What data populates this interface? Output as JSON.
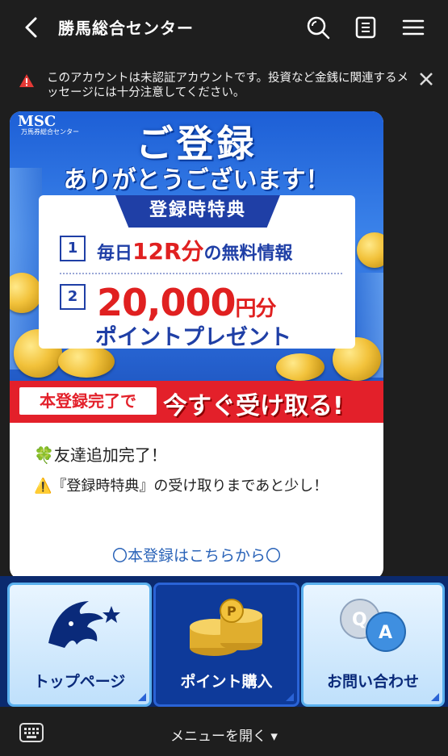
{
  "header": {
    "title": "勝馬総合センター",
    "back_icon": "chevron-left-icon",
    "search_icon": "search-icon",
    "notes_icon": "notes-icon",
    "menu_icon": "hamburger-menu-icon"
  },
  "warning": {
    "text": "このアカウントは未認証アカウントです。投資など金銭に関連するメッセージには十分注意してください。",
    "accent": "#e53935"
  },
  "banner": {
    "logo_text": "MSC",
    "logo_sub": "万馬券総合センター",
    "headline_1": "ご登録",
    "headline_2": "ありがとうございます！",
    "panel_title": "登録時特典",
    "item1_num": "1",
    "item1_pre": "毎日",
    "item1_red": "12R分",
    "item1_post": "の無料情報",
    "item2_num": "2",
    "item2_amount": "20,000",
    "item2_unit": "円分",
    "item2_line2": "ポイントプレゼント",
    "cta_left": "本登録完了で",
    "cta_right": "今すぐ受け取る!"
  },
  "message": {
    "line1": "🍀友達追加完了！",
    "line2": "⚠️『登録時特典』の受け取りまであと少し！",
    "link": "〇本登録はこちらから〇"
  },
  "rich_menu": {
    "items": [
      {
        "label": "トップページ",
        "icon": "lion-logo-icon"
      },
      {
        "label": "ポイント購入",
        "icon": "coin-stack-icon"
      },
      {
        "label": "お問い合わせ",
        "icon": "qa-bubbles-icon"
      }
    ]
  },
  "bottom": {
    "keyboard_icon": "keyboard-icon",
    "menu_open_label": "メニューを開く ▾"
  }
}
